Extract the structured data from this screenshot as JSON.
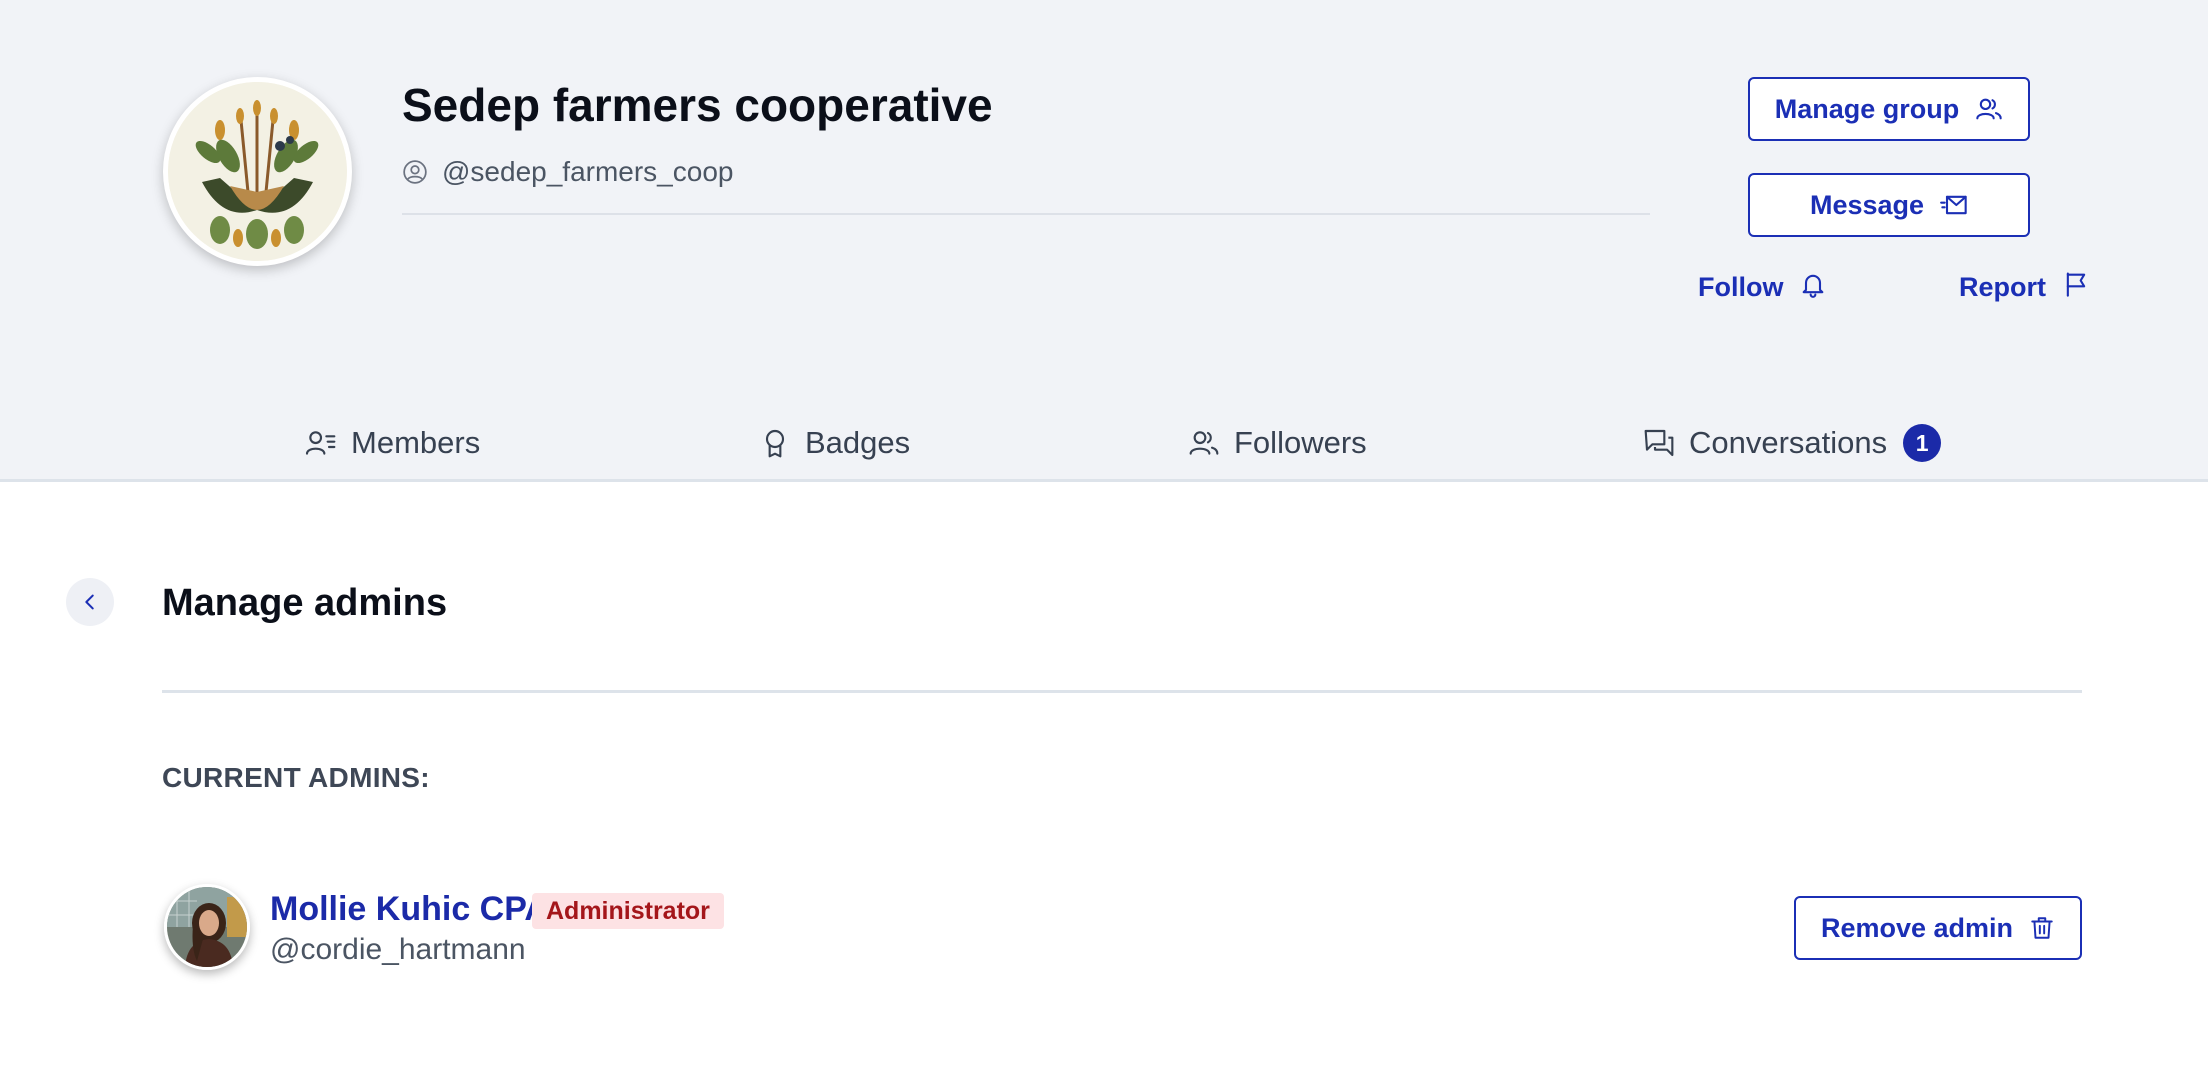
{
  "group": {
    "name": "Sedep farmers cooperative",
    "handle": "@sedep_farmers_coop",
    "avatar_icon": "wheat-leaves-hands-logo"
  },
  "actions": {
    "manage_group": "Manage group",
    "message": "Message",
    "follow": "Follow",
    "report": "Report"
  },
  "tabs": [
    {
      "label": "Members",
      "icon": "members-list-icon"
    },
    {
      "label": "Badges",
      "icon": "badge-icon"
    },
    {
      "label": "Followers",
      "icon": "followers-icon"
    },
    {
      "label": "Conversations",
      "icon": "conversations-icon",
      "count": "1"
    }
  ],
  "page": {
    "title": "Manage admins",
    "current_label": "CURRENT ADMINS:"
  },
  "admins": [
    {
      "name": "Mollie Kuhic CPA",
      "role": "Administrator",
      "handle": "@cordie_hartmann",
      "remove_label": "Remove admin"
    }
  ],
  "colors": {
    "accent": "#1b2fb5",
    "header_bg": "#f1f3f7",
    "badge_bg": "#1b2aa8",
    "role_badge_bg": "#fde2e4",
    "role_badge_text": "#a4161a"
  }
}
